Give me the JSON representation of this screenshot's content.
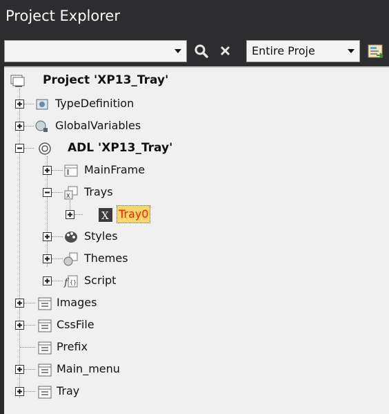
{
  "panel": {
    "title": "Project Explorer"
  },
  "toolbar": {
    "search": {
      "value": "",
      "placeholder": ""
    },
    "scope": {
      "selected": "Entire Proje"
    }
  },
  "tree": {
    "root": {
      "label": "Project 'XP13_Tray'",
      "icon": "project-icon"
    },
    "nodes": [
      {
        "label": "TypeDefinition",
        "icon": "type-definition-icon",
        "expanded": false
      },
      {
        "label": "GlobalVariables",
        "icon": "global-variables-icon",
        "expanded": false
      },
      {
        "label": "ADL 'XP13_Tray'",
        "icon": "adl-icon",
        "expanded": true
      },
      {
        "label": "MainFrame",
        "icon": "mainframe-icon",
        "expanded": false
      },
      {
        "label": "Trays",
        "icon": "trays-icon",
        "expanded": true
      },
      {
        "label": "Tray0",
        "icon": "tray-item-icon",
        "expanded": false,
        "selected": true
      },
      {
        "label": "Styles",
        "icon": "styles-icon",
        "expanded": false
      },
      {
        "label": "Themes",
        "icon": "themes-icon",
        "expanded": false
      },
      {
        "label": "Script",
        "icon": "script-icon",
        "expanded": false
      },
      {
        "label": "Images",
        "icon": "folder-icon",
        "expanded": false
      },
      {
        "label": "CssFile",
        "icon": "folder-icon",
        "expanded": false
      },
      {
        "label": "Prefix",
        "icon": "folder-icon"
      },
      {
        "label": "Main_menu",
        "icon": "folder-icon",
        "expanded": false
      },
      {
        "label": "Tray",
        "icon": "folder-icon",
        "expanded": false
      }
    ]
  },
  "colors": {
    "panel_bg": "#2d2d30",
    "tree_bg": "#f0f0f0",
    "selected_text": "#ff1a00",
    "selected_bg": "#fbd86c"
  }
}
